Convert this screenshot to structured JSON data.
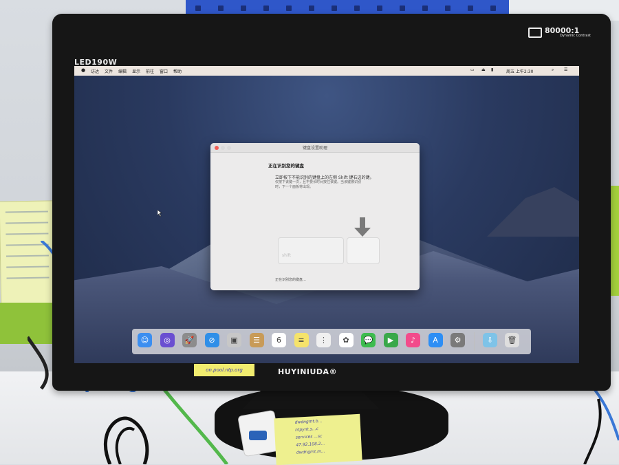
{
  "monitor": {
    "model": "LED190W",
    "contrast_ratio": "80000:1",
    "contrast_subtitle": "Dynamic Contrast",
    "brand": "HUYINIUDA®",
    "sticker_text": "on.pool.ntp.org"
  },
  "menubar": {
    "apple_icon": "apple-icon",
    "items": [
      "访达",
      "文件",
      "编辑",
      "显示",
      "前往",
      "窗口",
      "帮助"
    ],
    "clock": "周五 上午2:30",
    "status_icons": [
      "airplay-icon",
      "eject-icon",
      "search-icon",
      "list-icon"
    ]
  },
  "dialog": {
    "title": "键盘设置助理",
    "heading": "正在识别您的键盘",
    "instruction": "立即按下不能识别的键盘上的左侧 Shift 键右边的键。",
    "note": "仅按下该键一次，且不要长时间按住该键。当该键被识别时，下一个面板将出现。",
    "shift_key_label": "shift",
    "arrow_icon": "down-arrow-icon",
    "status": "正在识别您的键盘…"
  },
  "dock": {
    "apps": [
      {
        "icon": "finder-icon",
        "color": "#3b8ef0",
        "glyph": "☺"
      },
      {
        "icon": "siri-icon",
        "color": "#6a4fd1",
        "glyph": "◎"
      },
      {
        "icon": "launchpad-icon",
        "color": "#8c8c8c",
        "glyph": "🚀"
      },
      {
        "icon": "safari-icon",
        "color": "#2f8fe8",
        "glyph": "⊘"
      },
      {
        "icon": "photo-booth-icon",
        "color": "#c7c7c7",
        "glyph": "▣"
      },
      {
        "icon": "contacts-icon",
        "color": "#c89b58",
        "glyph": "☰"
      },
      {
        "icon": "calendar-icon",
        "color": "#ffffff",
        "glyph": "6"
      },
      {
        "icon": "notes-icon",
        "color": "#f5e36b",
        "glyph": "≡"
      },
      {
        "icon": "reminders-icon",
        "color": "#f0f0f0",
        "glyph": "⋮"
      },
      {
        "icon": "photos-icon",
        "color": "#ffffff",
        "glyph": "✿"
      },
      {
        "icon": "messages-icon",
        "color": "#3dbc4e",
        "glyph": "💬"
      },
      {
        "icon": "facetime-icon",
        "color": "#39a84a",
        "glyph": "▶"
      },
      {
        "icon": "itunes-icon",
        "color": "#f24b8b",
        "glyph": "♪"
      },
      {
        "icon": "app-store-icon",
        "color": "#2d8ef5",
        "glyph": "A"
      },
      {
        "icon": "system-preferences-icon",
        "color": "#7a7a7a",
        "glyph": "⚙"
      },
      {
        "icon": "downloads-folder-icon",
        "color": "#7ec3e8",
        "glyph": "⇩"
      },
      {
        "icon": "trash-icon",
        "color": "#dedede",
        "glyph": "🗑"
      }
    ]
  },
  "desk_note": {
    "lines": [
      "dwdngmt.b...",
      "ntpynt.s...c",
      "services ...sc",
      "47.92.108.2...",
      "dwdngmt.m..."
    ]
  }
}
